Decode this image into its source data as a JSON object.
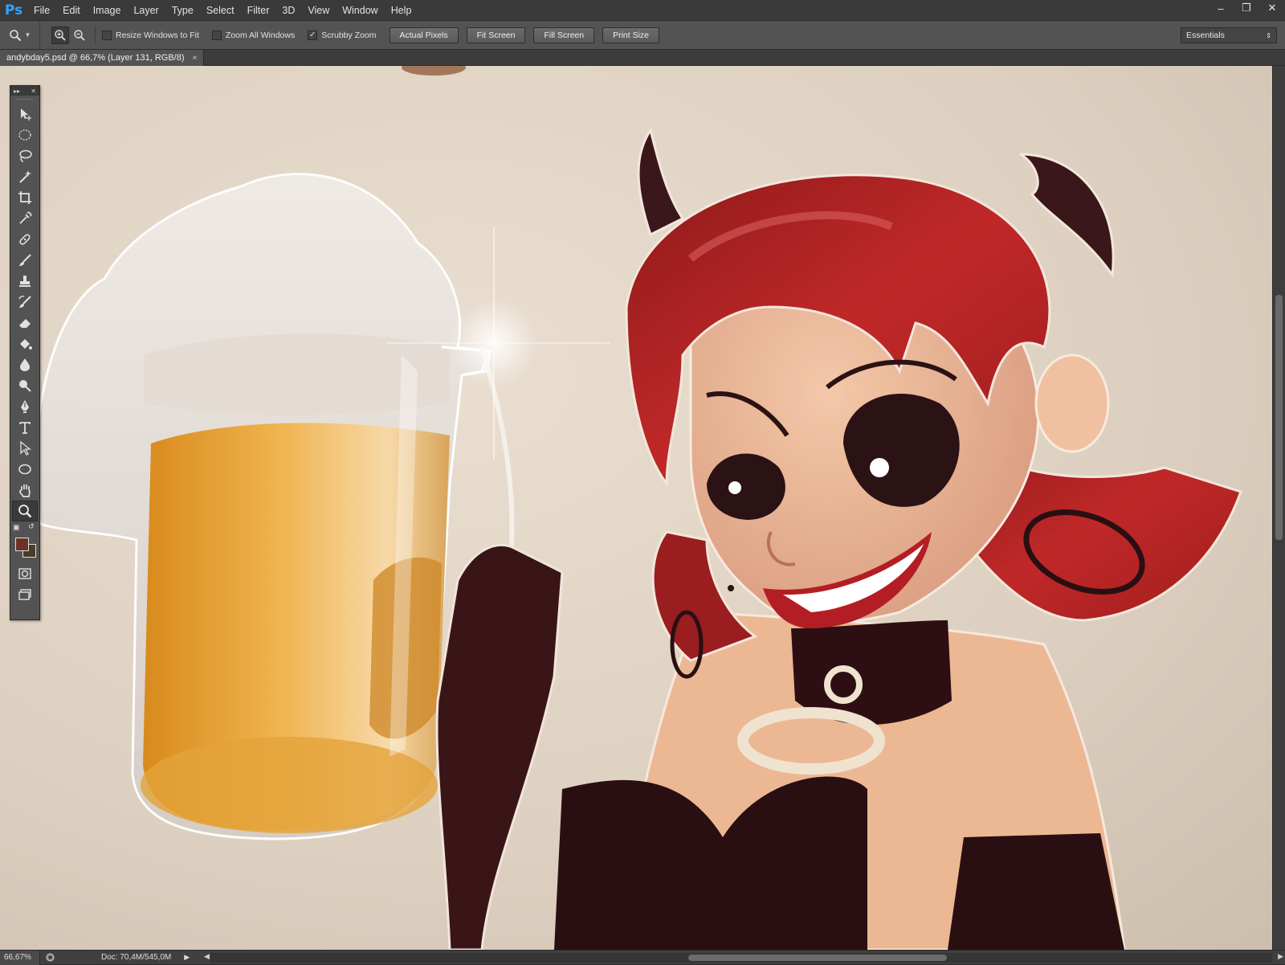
{
  "app": {
    "logo": "Ps"
  },
  "menu": [
    "File",
    "Edit",
    "Image",
    "Layer",
    "Type",
    "Select",
    "Filter",
    "3D",
    "View",
    "Window",
    "Help"
  ],
  "window_controls": {
    "minimize": "–",
    "restore": "❐",
    "close": "✕"
  },
  "options": {
    "tool_icon": "zoom-icon",
    "checkboxes": [
      {
        "label": "Resize Windows to Fit",
        "checked": false
      },
      {
        "label": "Zoom All Windows",
        "checked": false
      },
      {
        "label": "Scrubby Zoom",
        "checked": true
      }
    ],
    "buttons": [
      "Actual Pixels",
      "Fit Screen",
      "Fill Screen",
      "Print Size"
    ],
    "workspace": "Essentials"
  },
  "document_tab": {
    "title": "andybday5.psd @ 66,7% (Layer 131, RGB/8)",
    "close": "×"
  },
  "tools": [
    "move-tool-icon",
    "marquee-tool-icon",
    "lasso-tool-icon",
    "magic-wand-icon",
    "crop-tool-icon",
    "eyedropper-icon",
    "healing-brush-icon",
    "brush-tool-icon",
    "clone-stamp-icon",
    "history-brush-icon",
    "eraser-icon",
    "paint-bucket-icon",
    "blur-tool-icon",
    "dodge-tool-icon",
    "pen-tool-icon",
    "type-tool-icon",
    "path-selection-icon",
    "ellipse-tool-icon",
    "hand-tool-icon",
    "zoom-tool-icon"
  ],
  "colors": {
    "foreground": "#6b3326",
    "background": "#4a3c27"
  },
  "status": {
    "zoom": "66,67%",
    "doc": "Doc: 70,4M/545,0M"
  }
}
